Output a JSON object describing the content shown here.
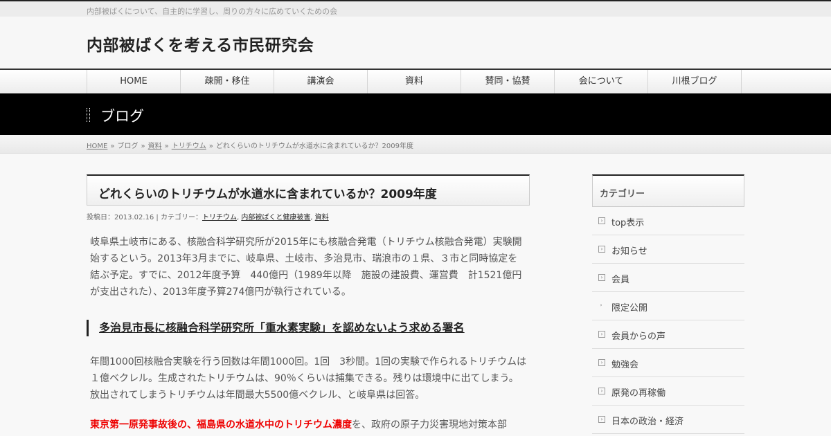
{
  "site": {
    "tagline": "内部被ばくについて、自主的に学習し、周りの方々に広めていくための会",
    "title": "内部被ばくを考える市民研究会"
  },
  "nav": {
    "items": [
      {
        "label": "HOME"
      },
      {
        "label": "疎開・移住"
      },
      {
        "label": "講演会"
      },
      {
        "label": "資料"
      },
      {
        "label": "賛同・協賛"
      },
      {
        "label": "会について"
      },
      {
        "label": "川根ブログ"
      }
    ]
  },
  "banner": {
    "title": "ブログ"
  },
  "breadcrumb": {
    "home": "HOME",
    "sep": "»",
    "blog": "ブログ",
    "shiryo": "資料",
    "tritium": "トリチウム",
    "current": "どれくらいのトリチウムが水道水に含まれているか？2009年度"
  },
  "post": {
    "title": "どれくらいのトリチウムが水道水に含まれているか？2009年度",
    "meta_prefix": "投稿日：2013.02.16 | カテゴリー：",
    "categories": [
      "トリチウム",
      "内部被ばくと健康被害",
      "資料"
    ],
    "para1": "岐阜県土岐市にある、核融合科学研究所が2015年にも核融合発電（トリチウム核融合発電）実験開始するという。2013年3月までに、岐阜県、土岐市、多治見市、瑞浪市の１県、３市と同時協定を結ぶ予定。すでに、2012年度予算　440億円（1989年以降　施設の建設費、運営費　計1521億円が支出された）、2013年度予算274億円が執行されている。",
    "heading": "多治見市長に核融合科学研究所「重水素実験」を認めないよう求める署名",
    "para2": "年間1000回核融合実験を行う回数は年間1000回。1回　3秒間。1回の実験で作られるトリチウムは１億ベクレル。生成されたトリチウムは、90％くらいは捕集できる。残りは環境中に出てしまう。放出されてしまうトリチウムは年間最大5500億ベクレル、と岐阜県は回答。",
    "para3_red": "東京第一原発事故後の、福島県の水道水中のトリチウム濃度",
    "para3_rest": "を、政府の原子力災害現地対策本部"
  },
  "sidebar": {
    "title": "カテゴリー",
    "items": [
      {
        "label": "top表示",
        "icon": "plus-box-icon"
      },
      {
        "label": "お知らせ",
        "icon": "plus-box-icon"
      },
      {
        "label": "会員",
        "icon": "plus-box-icon"
      },
      {
        "label": "限定公開",
        "icon": "small-arrow-icon"
      },
      {
        "label": "会員からの声",
        "icon": "plus-box-icon"
      },
      {
        "label": "勉強会",
        "icon": "plus-box-icon"
      },
      {
        "label": "原発の再稼働",
        "icon": "plus-box-icon"
      },
      {
        "label": "日本の政治・経済",
        "icon": "plus-box-icon"
      }
    ]
  }
}
